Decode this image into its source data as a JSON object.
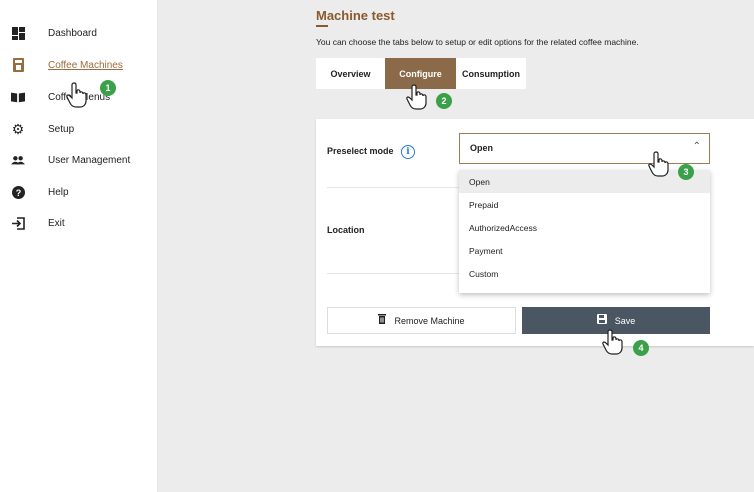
{
  "sidebar": {
    "items": [
      {
        "label": "Dashboard",
        "icon": "dashboard-icon"
      },
      {
        "label": "Coffee Machines",
        "icon": "coffee-machine-icon",
        "active": true
      },
      {
        "label": "Coffee Menus",
        "icon": "menu-book-icon"
      },
      {
        "label": "Setup",
        "icon": "gear-icon"
      },
      {
        "label": "User Management",
        "icon": "users-icon"
      },
      {
        "label": "Help",
        "icon": "help-icon"
      },
      {
        "label": "Exit",
        "icon": "exit-icon"
      }
    ]
  },
  "main": {
    "title": "Machine test",
    "description": "You can choose the tabs below to setup or edit options for the related coffee machine.",
    "tabs": [
      {
        "label": "Overview"
      },
      {
        "label": "Configure",
        "active": true
      },
      {
        "label": "Consumption"
      }
    ],
    "form": {
      "preselect_label": "Preselect mode",
      "location_label": "Location",
      "preselect_value": "Open",
      "options": [
        "Open",
        "Prepaid",
        "AuthorizedAccess",
        "Payment",
        "Custom"
      ]
    },
    "buttons": {
      "remove": "Remove Machine",
      "save": "Save"
    }
  },
  "steps": [
    "1",
    "2",
    "3",
    "4"
  ],
  "colors": {
    "accent": "#8b6a4a",
    "title": "#8a5a2e",
    "save_button": "#4b5663",
    "marker": "#3aa04a",
    "info": "#2a7bd6"
  }
}
